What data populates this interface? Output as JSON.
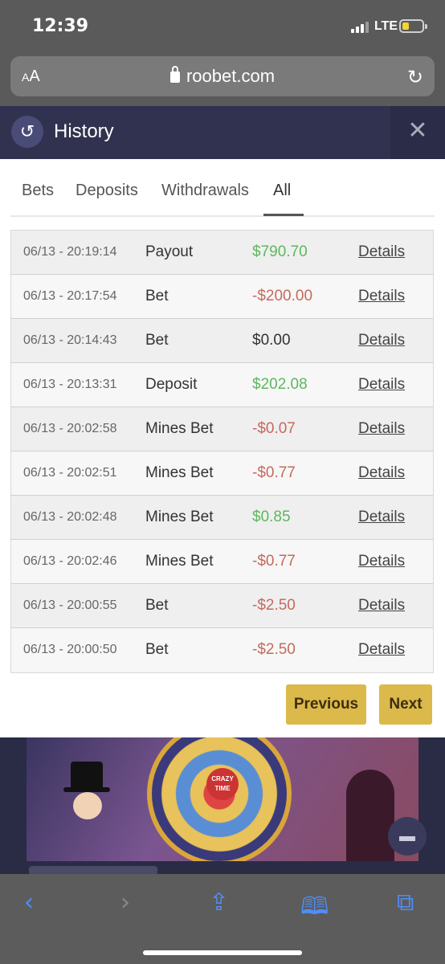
{
  "status_bar": {
    "time": "12:39",
    "network": "LTE"
  },
  "browser": {
    "text_size_label_small": "A",
    "text_size_label_large": "A",
    "url": "roobet.com"
  },
  "modal": {
    "title": "History",
    "tabs": [
      "Bets",
      "Deposits",
      "Withdrawals",
      "All"
    ],
    "active_tab": "All",
    "rows": [
      {
        "date": "06/13 - 20:19:14",
        "type": "Payout",
        "amount": "$790.70",
        "details": "Details"
      },
      {
        "date": "06/13 - 20:17:54",
        "type": "Bet",
        "amount": "-$200.00",
        "details": "Details"
      },
      {
        "date": "06/13 - 20:14:43",
        "type": "Bet",
        "amount": "$0.00",
        "details": "Details"
      },
      {
        "date": "06/13 - 20:13:31",
        "type": "Deposit",
        "amount": "$202.08",
        "details": "Details"
      },
      {
        "date": "06/13 - 20:02:58",
        "type": "Mines Bet",
        "amount": "-$0.07",
        "details": "Details"
      },
      {
        "date": "06/13 - 20:02:51",
        "type": "Mines Bet",
        "amount": "-$0.77",
        "details": "Details"
      },
      {
        "date": "06/13 - 20:02:48",
        "type": "Mines Bet",
        "amount": "$0.85",
        "details": "Details"
      },
      {
        "date": "06/13 - 20:02:46",
        "type": "Mines Bet",
        "amount": "-$0.77",
        "details": "Details"
      },
      {
        "date": "06/13 - 20:00:55",
        "type": "Bet",
        "amount": "-$2.50",
        "details": "Details"
      },
      {
        "date": "06/13 - 20:00:50",
        "type": "Bet",
        "amount": "-$2.50",
        "details": "Details"
      }
    ],
    "previous_label": "Previous",
    "next_label": "Next"
  },
  "background": {
    "game_badge": "CRAZY TIME"
  },
  "colors": {
    "positive": "#5cb85c",
    "negative": "#c56a5c",
    "button": "#dbb94a",
    "header": "#31324f"
  }
}
